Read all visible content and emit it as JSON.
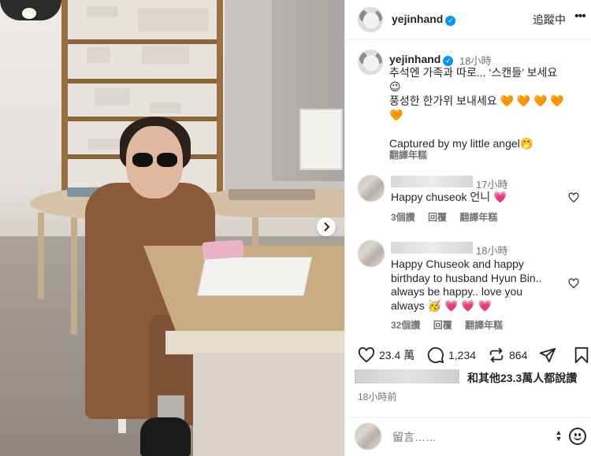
{
  "post": {
    "username": "yejinhand",
    "follow_label": "追蹤中",
    "more_label": "•••",
    "next_label": "›"
  },
  "caption": {
    "username": "yejinhand",
    "time": "18小時",
    "line1": "추석엔 가족과 따로... ‘스캔들’ 보세요",
    "line2": "😉",
    "line3": "풍성한 한가위 보내세요 🧡 🧡 🧡 🧡",
    "line4": "🧡",
    "line5": "Captured by my little angel🤭",
    "translate": "翻譯年糕"
  },
  "comments": [
    {
      "time": "17小時",
      "text": "Happy chuseok 언니 💗",
      "likes": "3個讚",
      "reply": "回覆",
      "translate": "翻譯年糕"
    },
    {
      "time": "18小時",
      "lines": [
        "Happy Chuseok and happy",
        "birthday to husband Hyun Bin..",
        "always be happy.. love you",
        "always 🥳 💗 💗 💗"
      ],
      "likes": "32個讚",
      "reply": "回覆",
      "translate": "翻譯年糕"
    }
  ],
  "actions": {
    "likes_count": "23.4 萬",
    "comments_count": "1,234",
    "reposts_count": "864"
  },
  "liked_by": "和其他23.3萬人都說讚",
  "posted_ago": "18小時前",
  "comment_box": {
    "placeholder": "留言……"
  },
  "colors": {
    "verified": "#0095f6",
    "secondary_text": "#737373",
    "primary_text": "#262626"
  }
}
